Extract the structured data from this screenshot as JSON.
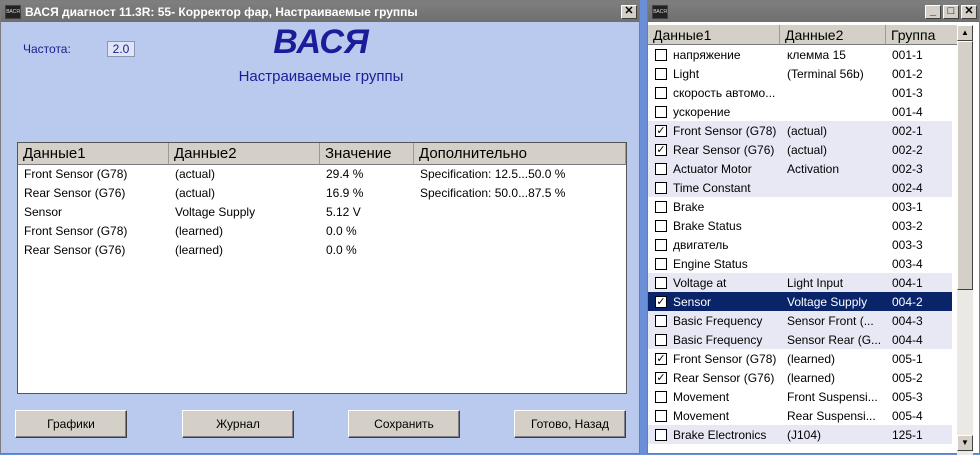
{
  "main": {
    "icon_text": "ВАСЯ",
    "title": "ВАСЯ диагност 11.3R: 55- Корректор фар,  Настраиваемые группы",
    "close_glyph": "✕",
    "freq_label": "Частота:",
    "freq_value": "2.0",
    "brand": "ВАСЯ",
    "subtitle": "Настраиваемые группы",
    "headers": [
      "Данные1",
      "Данные2",
      "Значение",
      "Дополнительно"
    ],
    "rows": [
      [
        "Front Sensor (G78)",
        "(actual)",
        "29.4 %",
        "Specification: 12.5...50.0 %"
      ],
      [
        "Rear Sensor (G76)",
        "(actual)",
        "16.9 %",
        "Specification: 50.0...87.5 %"
      ],
      [
        "Sensor",
        "Voltage Supply",
        "5.12 V",
        ""
      ],
      [
        "Front Sensor (G78)",
        "(learned)",
        "0.0 %",
        ""
      ],
      [
        "Rear Sensor (G76)",
        "(learned)",
        "0.0 %",
        ""
      ]
    ],
    "buttons": {
      "graphs": "Графики",
      "log": "Журнал",
      "save": "Сохранить",
      "done": "Готово, Назад"
    }
  },
  "groups": {
    "icon_text": "ВАСЯ",
    "min_glyph": "_",
    "max_glyph": "□",
    "close_glyph": "✕",
    "headers": [
      "Данные1",
      "Данные2",
      "Группа"
    ],
    "check_glyph": "✓",
    "rows": [
      {
        "d1": "напряжение",
        "d2": "клемма 15",
        "group": "001-1",
        "checked": false
      },
      {
        "d1": "Light",
        "d2": "(Terminal 56b)",
        "group": "001-2",
        "checked": false
      },
      {
        "d1": "скорость автомо...",
        "d2": "",
        "group": "001-3",
        "checked": false
      },
      {
        "d1": "ускорение",
        "d2": "",
        "group": "001-4",
        "checked": false
      },
      {
        "d1": "Front Sensor (G78)",
        "d2": "(actual)",
        "group": "002-1",
        "checked": true
      },
      {
        "d1": "Rear Sensor (G76)",
        "d2": "(actual)",
        "group": "002-2",
        "checked": true
      },
      {
        "d1": "Actuator Motor",
        "d2": "Activation",
        "group": "002-3",
        "checked": false
      },
      {
        "d1": "Time Constant",
        "d2": "",
        "group": "002-4",
        "checked": false
      },
      {
        "d1": "Brake",
        "d2": "",
        "group": "003-1",
        "checked": false
      },
      {
        "d1": "Brake Status",
        "d2": "",
        "group": "003-2",
        "checked": false
      },
      {
        "d1": "двигатель",
        "d2": "",
        "group": "003-3",
        "checked": false
      },
      {
        "d1": "Engine Status",
        "d2": "",
        "group": "003-4",
        "checked": false
      },
      {
        "d1": "Voltage at",
        "d2": "Light Input",
        "group": "004-1",
        "checked": false
      },
      {
        "d1": "Sensor",
        "d2": "Voltage Supply",
        "group": "004-2",
        "checked": true
      },
      {
        "d1": "Basic Frequency",
        "d2": "Sensor Front (...",
        "group": "004-3",
        "checked": false
      },
      {
        "d1": "Basic Frequency",
        "d2": "Sensor Rear (G...",
        "group": "004-4",
        "checked": false
      },
      {
        "d1": "Front Sensor (G78)",
        "d2": "(learned)",
        "group": "005-1",
        "checked": true
      },
      {
        "d1": "Rear Sensor (G76)",
        "d2": "(learned)",
        "group": "005-2",
        "checked": true
      },
      {
        "d1": "Movement",
        "d2": "Front Suspensi...",
        "group": "005-3",
        "checked": false
      },
      {
        "d1": "Movement",
        "d2": "Rear Suspensi...",
        "group": "005-4",
        "checked": false
      },
      {
        "d1": "Brake Electronics",
        "d2": "(J104)",
        "group": "125-1",
        "checked": false
      }
    ],
    "scroll_up_glyph": "▲",
    "scroll_down_glyph": "▼"
  }
}
